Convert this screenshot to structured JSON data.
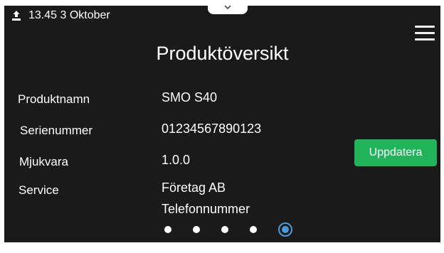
{
  "status_bar": {
    "icon": "upload-icon",
    "datetime": "13.45 3 Oktober"
  },
  "title": "Produktöversikt",
  "product_info": [
    {
      "label": "Produktnamn",
      "value": "SMO S40"
    },
    {
      "label": "Serienummer",
      "value": "01234567890123"
    },
    {
      "label": "Mjukvara",
      "value": "1.0.0"
    },
    {
      "label": "Service",
      "value": "Företag AB",
      "value2": "Telefonnummer"
    }
  ],
  "update_button": "Uppdatera",
  "pagination": {
    "total": 5,
    "active_index": 4
  },
  "colors": {
    "background": "#1a1a1a",
    "accent_green": "#22b45a",
    "active_dot": "#4a9ad8"
  }
}
